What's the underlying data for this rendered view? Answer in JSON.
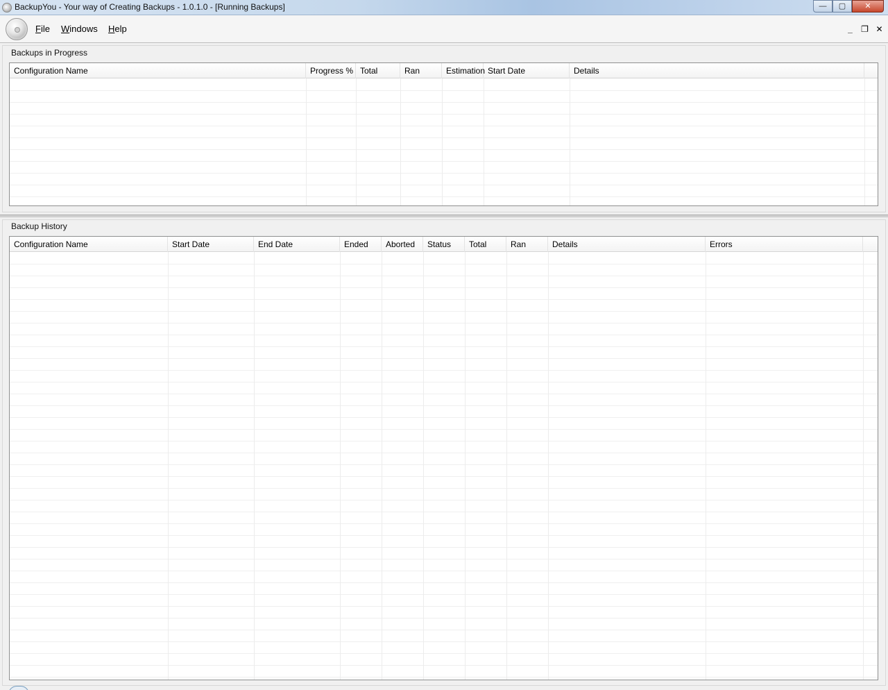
{
  "window": {
    "title": "BackupYou - Your way of Creating Backups - 1.0.1.0 - [Running Backups]",
    "controls": {
      "minimize": "—",
      "maximize": "▢",
      "close": "✕"
    }
  },
  "menu": {
    "items": [
      {
        "label": "File",
        "accel": "F",
        "rest": "ile"
      },
      {
        "label": "Windows",
        "accel": "W",
        "rest": "indows"
      },
      {
        "label": "Help",
        "accel": "H",
        "rest": "elp"
      }
    ],
    "mdi_controls": {
      "minimize": "_",
      "restore": "❐",
      "close": "✕"
    }
  },
  "progress_panel": {
    "title": "Backups in Progress",
    "columns": [
      "Configuration Name",
      "Progress %",
      "Total",
      "Ran",
      "Estimation",
      "Start Date",
      "Details"
    ],
    "rows": []
  },
  "history_panel": {
    "title": "Backup History",
    "columns": [
      "Configuration Name",
      "Start Date",
      "End Date",
      "Ended",
      "Aborted",
      "Status",
      "Total",
      "Ran",
      "Details",
      "Errors"
    ],
    "rows": []
  }
}
